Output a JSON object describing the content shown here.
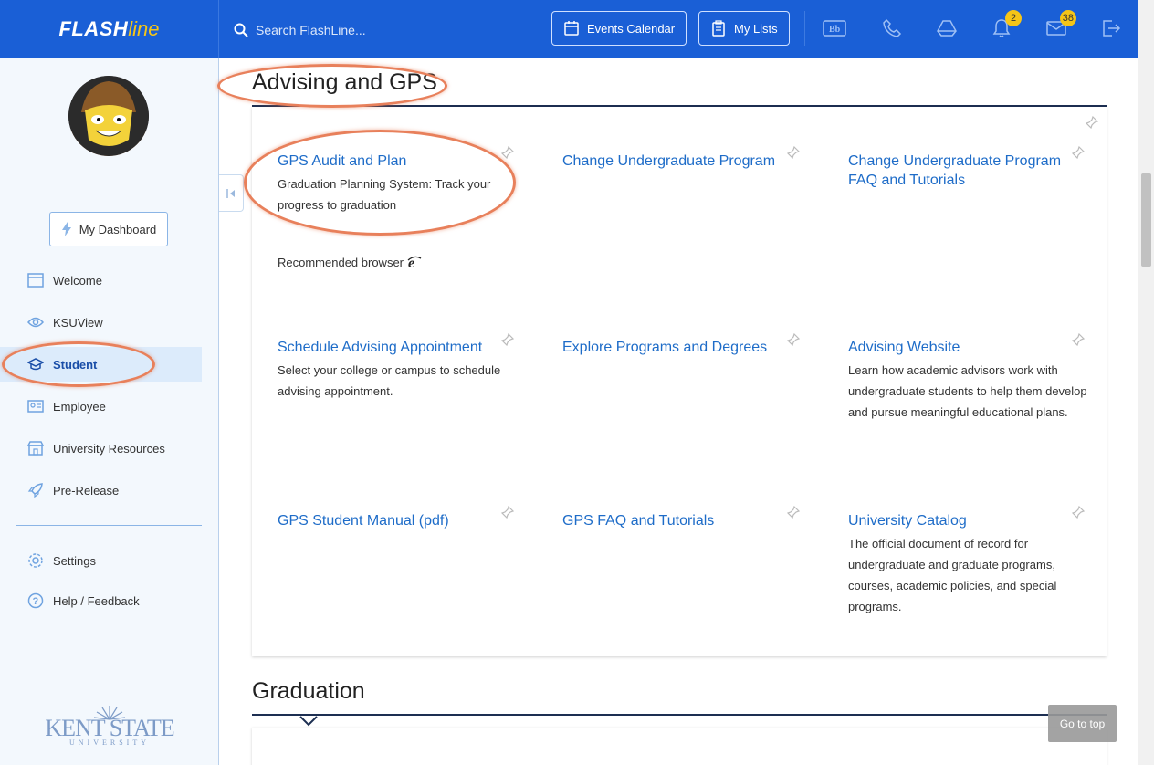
{
  "brand": {
    "part1": "FLASH",
    "part2": "line"
  },
  "search": {
    "placeholder": "Search FlashLine..."
  },
  "toolbar": {
    "events_calendar": "Events Calendar",
    "my_lists": "My Lists",
    "notifications_count": "2",
    "mail_count": "38"
  },
  "sidebar": {
    "dashboard_label": "My Dashboard",
    "items": [
      {
        "label": "Welcome"
      },
      {
        "label": "KSUView"
      },
      {
        "label": "Student"
      },
      {
        "label": "Employee"
      },
      {
        "label": "University Resources"
      },
      {
        "label": "Pre-Release"
      },
      {
        "label": "Settings"
      },
      {
        "label": "Help / Feedback"
      }
    ],
    "ksu_name": "KENT STATE",
    "ksu_sub": "UNIVERSITY"
  },
  "main": {
    "section1_title": "Advising and GPS",
    "tiles": [
      {
        "link": "GPS Audit and Plan",
        "desc": "Graduation Planning System: Track your progress to graduation"
      },
      {
        "link": "Change Undergraduate Program",
        "desc": ""
      },
      {
        "link": "Change Undergraduate Program FAQ and Tutorials",
        "desc": ""
      },
      {
        "link": "Schedule Advising Appointment",
        "desc": "Select your college or campus to schedule advising appointment."
      },
      {
        "link": "Explore Programs and Degrees",
        "desc": ""
      },
      {
        "link": "Advising Website",
        "desc": "Learn how academic advisors work with undergraduate students to help them develop and pursue meaningful educational plans."
      },
      {
        "link": "GPS Student Manual (pdf)",
        "desc": ""
      },
      {
        "link": "GPS FAQ and Tutorials",
        "desc": ""
      },
      {
        "link": "University Catalog",
        "desc": "The official document of record for undergraduate and graduate programs, courses, academic policies, and special programs."
      }
    ],
    "recommended_browser": "Recommended browser",
    "section2_title": "Graduation",
    "go_to_top": "Go to top"
  },
  "colors": {
    "topbar": "#1a5fd6",
    "link": "#1e6cc8",
    "badge": "#f5c518",
    "highlight": "#e8805b"
  }
}
